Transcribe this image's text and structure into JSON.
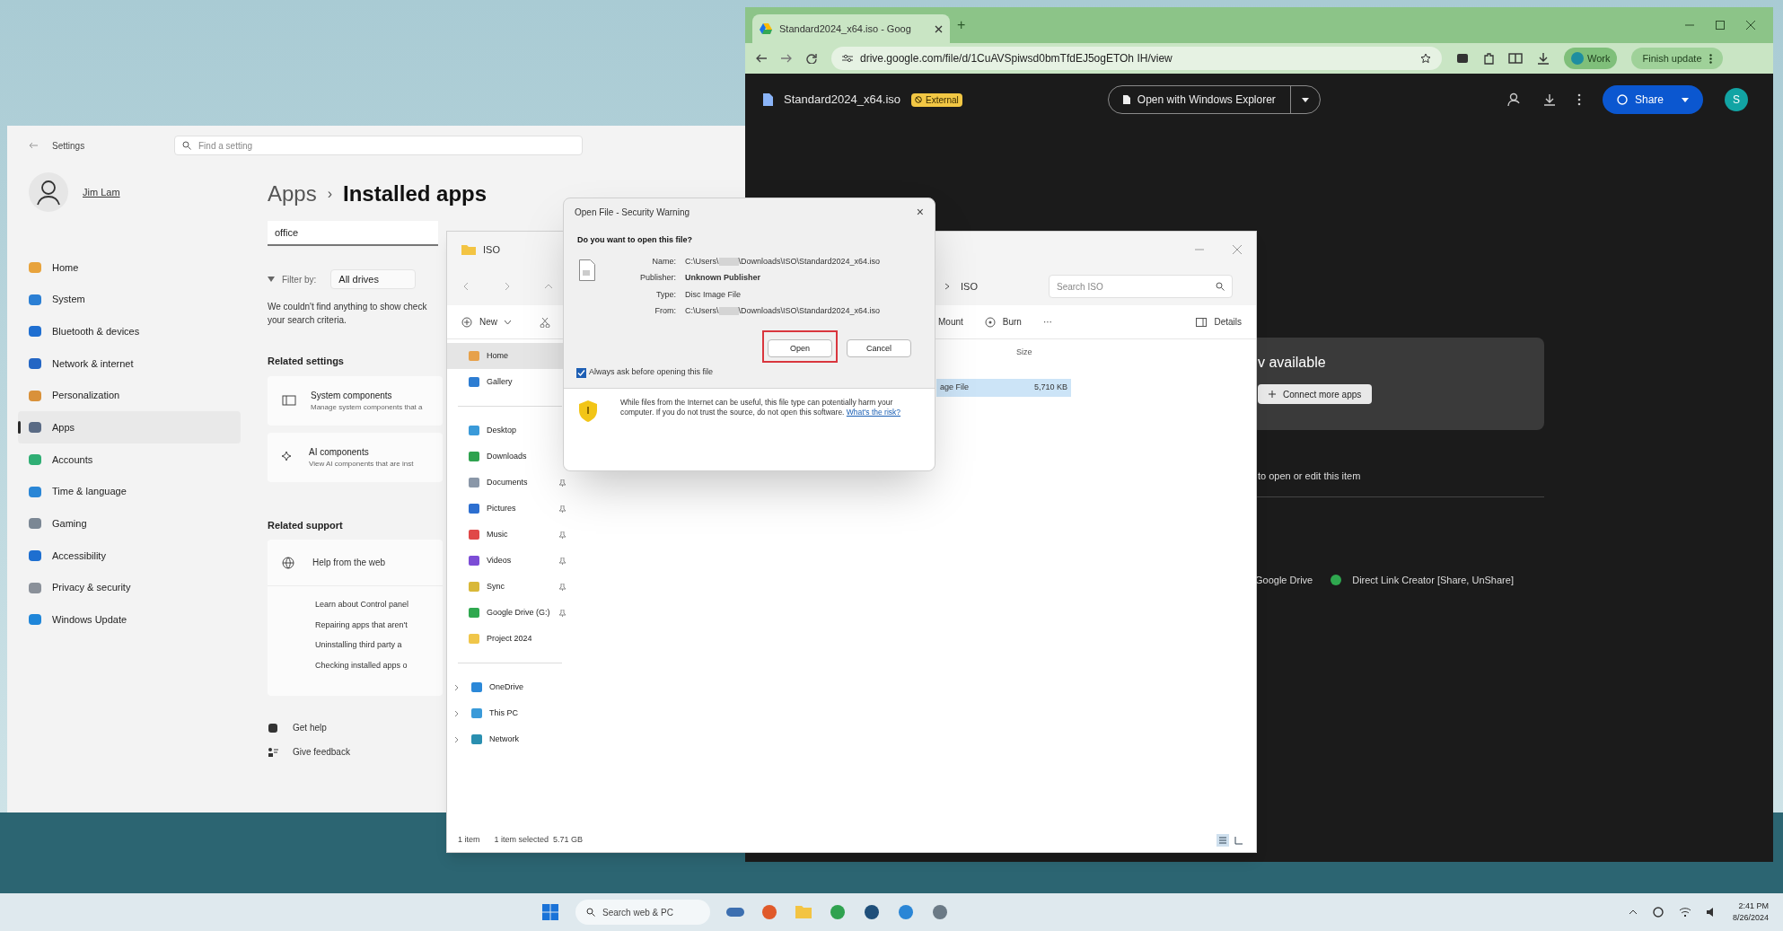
{
  "settings": {
    "title": "Settings",
    "search_placeholder": "Find a setting",
    "user_name": "Jim Lam",
    "nav": [
      {
        "label": "Home",
        "selected": false,
        "color": "#e8a33c"
      },
      {
        "label": "System",
        "selected": false,
        "color": "#2b7fd4"
      },
      {
        "label": "Bluetooth & devices",
        "selected": false,
        "color": "#1f6fd1"
      },
      {
        "label": "Network & internet",
        "selected": false,
        "color": "#2466c4"
      },
      {
        "label": "Personalization",
        "selected": false,
        "color": "#d9913a"
      },
      {
        "label": "Apps",
        "selected": true,
        "color": "#5a6b85"
      },
      {
        "label": "Accounts",
        "selected": false,
        "color": "#2fae74"
      },
      {
        "label": "Time & language",
        "selected": false,
        "color": "#2a86d6"
      },
      {
        "label": "Gaming",
        "selected": false,
        "color": "#7b8794"
      },
      {
        "label": "Accessibility",
        "selected": false,
        "color": "#1e6fd0"
      },
      {
        "label": "Privacy & security",
        "selected": false,
        "color": "#8a9099"
      },
      {
        "label": "Windows Update",
        "selected": false,
        "color": "#1f86d9"
      }
    ],
    "breadcrumb": {
      "parent": "Apps",
      "separator": "›",
      "current": "Installed apps"
    },
    "app_search": {
      "value": "office"
    },
    "filter": {
      "label": "Filter by:",
      "value": "All drives"
    },
    "empty_message": "We couldn't find anything to show check your search criteria.",
    "related_settings": {
      "heading": "Related settings",
      "cards": [
        {
          "title": "System components",
          "subtitle": "Manage system components that a"
        },
        {
          "title": "AI components",
          "subtitle": "View AI components that are inst"
        }
      ]
    },
    "related_support": {
      "heading": "Related support",
      "section": "Help from the web",
      "links": [
        "Learn about Control panel",
        "Repairing apps that aren't",
        "Uninstalling third party a",
        "Checking installed apps o"
      ]
    },
    "footer_links": [
      "Get help",
      "Give feedback"
    ]
  },
  "browser": {
    "tab_title": "Standard2024_x64.iso - Goog",
    "new_tab": "+",
    "address": "drive.google.com/file/d/1CuAVSpiwsd0bmTfdEJ5ogETOh IH/view",
    "profile": "Work",
    "update_button": "Finish update",
    "drive": {
      "file_name": "Standard2024_x64.iso",
      "badge": "External",
      "open_with": "Open with Windows Explorer",
      "share": "Share",
      "avatar": "S",
      "card_title": "v available",
      "card_button": "Connect more apps",
      "hint": "to open or edit this item",
      "apps": [
        "Google Drive",
        "Direct Link Creator [Share, UnShare]"
      ]
    }
  },
  "explorer": {
    "title": "ISO",
    "address": "ISO",
    "search_placeholder": "Search ISO",
    "new_button": "New",
    "commands": [
      "Mount",
      "Burn",
      "···"
    ],
    "details": "Details",
    "column": "Size",
    "row": {
      "type": "age File",
      "size": "5,710 KB",
      "selected": true
    },
    "sidebar": [
      [
        {
          "label": "Home",
          "selected": true,
          "pinned": false,
          "expandable": false
        },
        {
          "label": "Gallery",
          "selected": false,
          "pinned": false,
          "expandable": false
        }
      ],
      [
        {
          "label": "Desktop",
          "selected": false,
          "pinned": false,
          "expandable": false
        },
        {
          "label": "Downloads",
          "selected": false,
          "pinned": false,
          "expandable": false
        },
        {
          "label": "Documents",
          "selected": false,
          "pinned": true,
          "expandable": false
        },
        {
          "label": "Pictures",
          "selected": false,
          "pinned": true,
          "expandable": false
        },
        {
          "label": "Music",
          "selected": false,
          "pinned": true,
          "expandable": false
        },
        {
          "label": "Videos",
          "selected": false,
          "pinned": true,
          "expandable": false
        },
        {
          "label": "Sync",
          "selected": false,
          "pinned": true,
          "expandable": false
        },
        {
          "label": "Google Drive (G:)",
          "selected": false,
          "pinned": true,
          "expandable": false
        },
        {
          "label": "Project 2024",
          "selected": false,
          "pinned": false,
          "expandable": false
        }
      ],
      [
        {
          "label": "OneDrive",
          "selected": false,
          "pinned": false,
          "expandable": true
        },
        {
          "label": "This PC",
          "selected": false,
          "pinned": false,
          "expandable": true
        },
        {
          "label": "Network",
          "selected": false,
          "pinned": false,
          "expandable": true
        }
      ]
    ],
    "status": [
      "1 item",
      "1 item selected  5.71 GB"
    ]
  },
  "dialog": {
    "title": "Open File - Security Warning",
    "close": "×",
    "question": "Do you want to open this file?",
    "fields": [
      {
        "label": "Name:",
        "prefix": "C:\\Users\\",
        "suffix": "\\Downloads\\ISO\\Standard2024_x64.iso",
        "redacted": true
      },
      {
        "label": "Publisher:",
        "value": "Unknown Publisher",
        "redacted": false
      },
      {
        "label": "Type:",
        "value": "Disc Image File",
        "redacted": false
      },
      {
        "label": "From:",
        "prefix": "C:\\Users\\",
        "suffix": "\\Downloads\\ISO\\Standard2024_x64.iso",
        "redacted": true
      }
    ],
    "buttons": [
      {
        "label": "Open",
        "highlighted": true
      },
      {
        "label": "Cancel",
        "highlighted": false
      }
    ],
    "checkbox": {
      "label": "Always ask before opening this file",
      "checked": true
    },
    "warning": "While files from the Internet can be useful, this file type can potentially harm your computer. If you do not trust the source, do not open this software.",
    "warning_link": "What's the risk?"
  },
  "taskbar": {
    "search_placeholder": "Search web & PC",
    "time": "2:41 PM",
    "date": "8/26/2024"
  }
}
